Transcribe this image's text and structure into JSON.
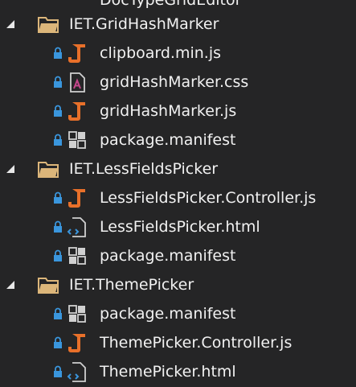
{
  "tree": {
    "partial_top_label": "DocTypeGridEditor",
    "folders": [
      {
        "name": "IET.GridHashMarker",
        "files": [
          {
            "name": "clipboard.min.js",
            "icon": "js-file-icon"
          },
          {
            "name": "gridHashMarker.css",
            "icon": "css-file-icon"
          },
          {
            "name": "gridHashMarker.js",
            "icon": "js-file-icon"
          },
          {
            "name": "package.manifest",
            "icon": "manifest-file-icon"
          }
        ]
      },
      {
        "name": "IET.LessFieldsPicker",
        "files": [
          {
            "name": "LessFieldsPicker.Controller.js",
            "icon": "js-file-icon"
          },
          {
            "name": "LessFieldsPicker.html",
            "icon": "html-file-icon"
          },
          {
            "name": "package.manifest",
            "icon": "manifest-file-icon"
          }
        ]
      },
      {
        "name": "IET.ThemePicker",
        "files": [
          {
            "name": "package.manifest",
            "icon": "manifest-file-icon"
          },
          {
            "name": "ThemePicker.Controller.js",
            "icon": "js-file-icon"
          },
          {
            "name": "ThemePicker.html",
            "icon": "html-file-icon"
          }
        ]
      }
    ]
  },
  "colors": {
    "background": "#252526",
    "text": "#f1f1f1",
    "folder": "#dcb67a",
    "js_orange": "#e8702a",
    "lock_blue": "#3a96dd",
    "css_pink": "#c5468b"
  }
}
